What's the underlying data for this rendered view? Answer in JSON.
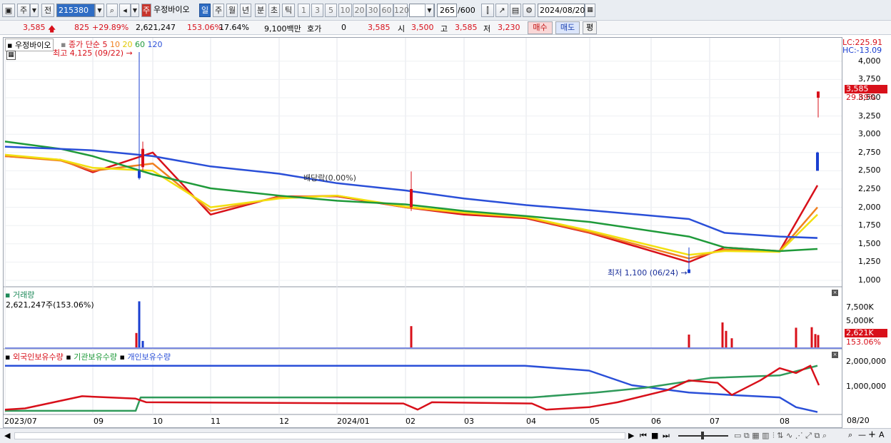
{
  "toolbar": {
    "mode_stock": "주",
    "mode_prev": "전",
    "code": "215380",
    "name": "우정바이오",
    "periods": [
      "일",
      "주",
      "월",
      "년",
      "분",
      "초",
      "틱"
    ],
    "selected_period": "일",
    "intervals": [
      "1",
      "3",
      "5",
      "10",
      "20",
      "30",
      "60",
      "120"
    ],
    "count": "265",
    "count_max": "/600",
    "date": "2024/08/20"
  },
  "quote": {
    "price": "3,585",
    "change": "825",
    "change_pct": "+29.89%",
    "volume": "2,621,247",
    "volume_ratio": "153.06%",
    "turnover": "17.64%",
    "amount": "9,100백만",
    "bid_label": "호가",
    "bid_value": "0",
    "bid_price": "3,585",
    "open_label": "시",
    "open": "3,500",
    "high_label": "고",
    "high": "3,585",
    "low_label": "저",
    "low": "3,230",
    "buy_label": "매수",
    "sell_label": "매도",
    "eval_label": "평"
  },
  "price_panel": {
    "title": "우정바이오",
    "ma_label": "종가 단순",
    "ma_periods": [
      "5",
      "10",
      "20",
      "60",
      "120"
    ],
    "high_annotation": "최고 4,125 (09/22)",
    "low_annotation": "최저 1,100 (06/24)",
    "dividend_annotation": "배당락(0.00%)",
    "lc": "LC:225.91",
    "hc": "HC:-13.09",
    "current_price": "3,585",
    "current_pct": "29.89%",
    "yticks": [
      "4,000",
      "3,750",
      "3,500",
      "3,250",
      "3,000",
      "2,750",
      "2,500",
      "2,250",
      "2,000",
      "1,750",
      "1,500",
      "1,250",
      "1,000"
    ]
  },
  "volume_panel": {
    "title": "거래량",
    "value_text": "2,621,247주(153.06%)",
    "yticks": [
      "7,500K",
      "5,000K"
    ],
    "current": "2,621K",
    "current_pct": "153.06%"
  },
  "holdings_panel": {
    "series": [
      "외국인보유수량",
      "기관보유수량",
      "개인보유수량"
    ],
    "yticks": [
      "2,000,000",
      "1,000,000"
    ]
  },
  "xaxis": {
    "labels": [
      "2023/07",
      "09",
      "10",
      "11",
      "12",
      "2024/01",
      "02",
      "03",
      "04",
      "05",
      "06",
      "07",
      "08",
      "08/20"
    ]
  },
  "colors": {
    "up": "#d8101a",
    "down": "#1a3fd0",
    "ma5": "#d8101a",
    "ma10": "#f08020",
    "ma20": "#f2e010",
    "ma60": "#1f9a3a",
    "ma120": "#2a4fd8"
  },
  "chart_data": {
    "type": "line",
    "ylim": [
      1000,
      4125
    ],
    "x": [
      "2023/07",
      "08",
      "09",
      "10",
      "11",
      "12",
      "2024/01",
      "02",
      "03",
      "04",
      "05",
      "06",
      "07",
      "08",
      "08/20"
    ],
    "series": [
      {
        "name": "5",
        "values": [
          2700,
          2650,
          2480,
          2750,
          1900,
          2150,
          2150,
          2000,
          1900,
          1850,
          1650,
          1250,
          1450,
          1400,
          2300
        ]
      },
      {
        "name": "10",
        "values": [
          2700,
          2640,
          2500,
          2600,
          1950,
          2140,
          2160,
          2000,
          1920,
          1860,
          1660,
          1300,
          1420,
          1400,
          2000
        ]
      },
      {
        "name": "20",
        "values": [
          2720,
          2650,
          2540,
          2500,
          2000,
          2120,
          2160,
          2010,
          1930,
          1870,
          1680,
          1350,
          1400,
          1390,
          1900
        ]
      },
      {
        "name": "60",
        "values": [
          2900,
          2800,
          2700,
          2450,
          2260,
          2160,
          2090,
          2040,
          1950,
          1880,
          1800,
          1600,
          1450,
          1400,
          1430
        ]
      },
      {
        "name": "120",
        "values": [
          2830,
          2800,
          2780,
          2700,
          2560,
          2460,
          2330,
          2230,
          2120,
          2030,
          1960,
          1840,
          1650,
          1600,
          1580
        ]
      }
    ]
  }
}
